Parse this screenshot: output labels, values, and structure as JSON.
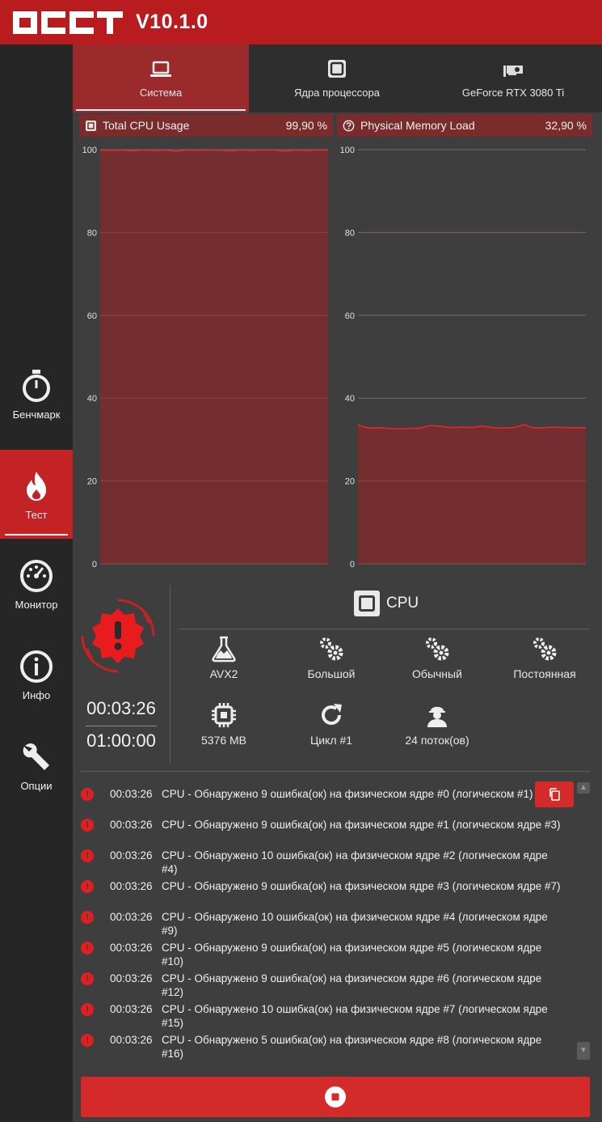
{
  "app": {
    "version": "V10.1.0",
    "logo_text": "OCCT"
  },
  "sidebar": {
    "items": [
      {
        "label": "Бенчмарк",
        "icon": "stopwatch-icon"
      },
      {
        "label": "Тест",
        "icon": "flame-icon",
        "active": true
      },
      {
        "label": "Монитор",
        "icon": "gauge-icon"
      },
      {
        "label": "Инфо",
        "icon": "info-icon"
      },
      {
        "label": "Опции",
        "icon": "wrench-icon"
      }
    ]
  },
  "tabs": [
    {
      "label": "Система",
      "icon": "laptop-icon",
      "active": true
    },
    {
      "label": "Ядра процессора",
      "icon": "cpu-icon"
    },
    {
      "label": "GeForce RTX 3080 Ti",
      "icon": "gpu-icon"
    }
  ],
  "charts": [
    {
      "title": "Total CPU Usage",
      "value": "99,90 %",
      "icon": "cpu-small-icon"
    },
    {
      "title": "Physical Memory Load",
      "value": "32,90 %",
      "icon": "question-icon"
    }
  ],
  "chart_data": [
    {
      "type": "area",
      "title": "Total CPU Usage",
      "ylim": [
        0,
        100
      ],
      "yticks": [
        "100",
        "80",
        "60",
        "40",
        "20",
        "0"
      ],
      "grid": true,
      "values": [
        99.9,
        99.8,
        99.9,
        99.7,
        99.9,
        99.8,
        99.9,
        99.6,
        99.9,
        99.8,
        99.9,
        99.9,
        99.7,
        99.9,
        99.8,
        99.9,
        99.9,
        99.6,
        99.9,
        99.8,
        99.9,
        99.9
      ]
    },
    {
      "type": "area",
      "title": "Physical Memory Load",
      "ylim": [
        0,
        100
      ],
      "yticks": [
        "100",
        "80",
        "60",
        "40",
        "20",
        "0"
      ],
      "grid": true,
      "values": [
        33.5,
        32.8,
        32.9,
        32.7,
        32.6,
        32.7,
        32.8,
        33.4,
        33.2,
        32.9,
        33.0,
        32.9,
        33.3,
        32.9,
        32.8,
        32.9,
        33.6,
        32.8,
        32.9,
        33.0,
        32.9,
        32.9,
        32.9
      ]
    }
  ],
  "test": {
    "elapsed": "00:03:26",
    "duration": "01:00:00",
    "target": "CPU",
    "params": [
      {
        "label": "AVX2",
        "icon": "flask-icon"
      },
      {
        "label": "Большой",
        "icon": "gears-icon"
      },
      {
        "label": "Обычный",
        "icon": "gears-icon"
      },
      {
        "label": "Постоянная",
        "icon": "gears-icon"
      },
      {
        "label": "5376 MB",
        "icon": "chip-icon"
      },
      {
        "label": "Цикл #1",
        "icon": "refresh-icon"
      },
      {
        "label": "24 поток(ов)",
        "icon": "worker-icon"
      }
    ]
  },
  "log": [
    {
      "time": "00:03:26",
      "message": "CPU - Обнаружено 9 ошибка(ок) на физическом ядре #0 (логическом #1)"
    },
    {
      "time": "00:03:26",
      "message": "CPU - Обнаружено 9 ошибка(ок) на физическом ядре #1 (логическом ядре #3)"
    },
    {
      "time": "00:03:26",
      "message": "CPU - Обнаружено 10 ошибка(ок) на физическом ядре #2 (логическом ядре #4)"
    },
    {
      "time": "00:03:26",
      "message": "CPU - Обнаружено 9 ошибка(ок) на физическом ядре #3 (логическом ядре #7)"
    },
    {
      "time": "00:03:26",
      "message": "CPU - Обнаружено 10 ошибка(ок) на физическом ядре #4 (логическом ядре #9)"
    },
    {
      "time": "00:03:26",
      "message": "CPU - Обнаружено 9 ошибка(ок) на физическом ядре #5 (логическом ядре #10)"
    },
    {
      "time": "00:03:26",
      "message": "CPU - Обнаружено 9 ошибка(ок) на физическом ядре #6 (логическом ядре #12)"
    },
    {
      "time": "00:03:26",
      "message": "CPU - Обнаружено 10 ошибка(ок) на физическом ядре #7 (логическом ядре #15)"
    },
    {
      "time": "00:03:26",
      "message": "CPU - Обнаружено 5 ошибка(ок) на физическом ядре #8 (логическом ядре #16)"
    }
  ],
  "colors": {
    "accent": "#c42326",
    "titlebar": "#b81c1e",
    "chart_fill": "#7a2c2d",
    "chart_line": "#e8282a"
  }
}
